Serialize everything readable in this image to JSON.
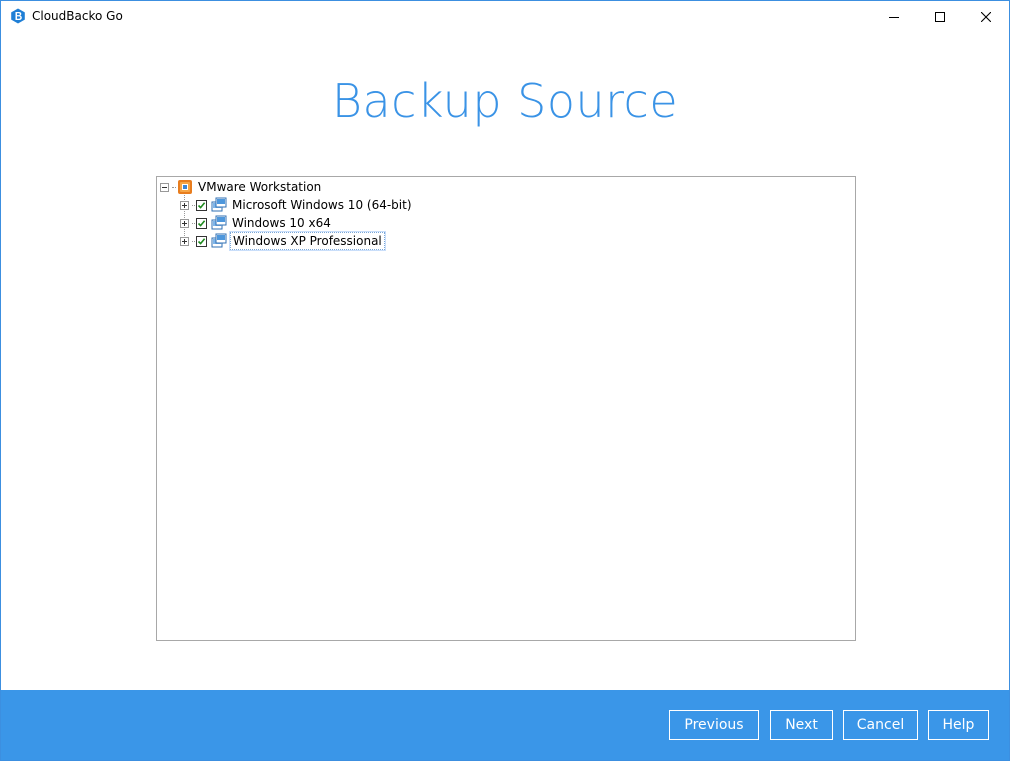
{
  "window": {
    "title": "CloudBacko Go"
  },
  "page": {
    "title": "Backup Source"
  },
  "tree": {
    "root": {
      "label": "VMware Workstation",
      "expanded": true,
      "icon": "vmware-icon"
    },
    "children": [
      {
        "label": "Microsoft Windows 10 (64-bit)",
        "checked": true,
        "expanded": false,
        "icon": "virtual-machine-icon"
      },
      {
        "label": "Windows 10 x64",
        "checked": true,
        "expanded": false,
        "icon": "virtual-machine-icon"
      },
      {
        "label": "Windows XP Professional",
        "checked": true,
        "expanded": false,
        "icon": "virtual-machine-icon",
        "focused": true
      }
    ]
  },
  "footer": {
    "previous_label": "Previous",
    "next_label": "Next",
    "cancel_label": "Cancel",
    "help_label": "Help"
  },
  "colors": {
    "accent": "#3a96e8",
    "title": "#3a93e6",
    "check": "#1e8a1e"
  }
}
